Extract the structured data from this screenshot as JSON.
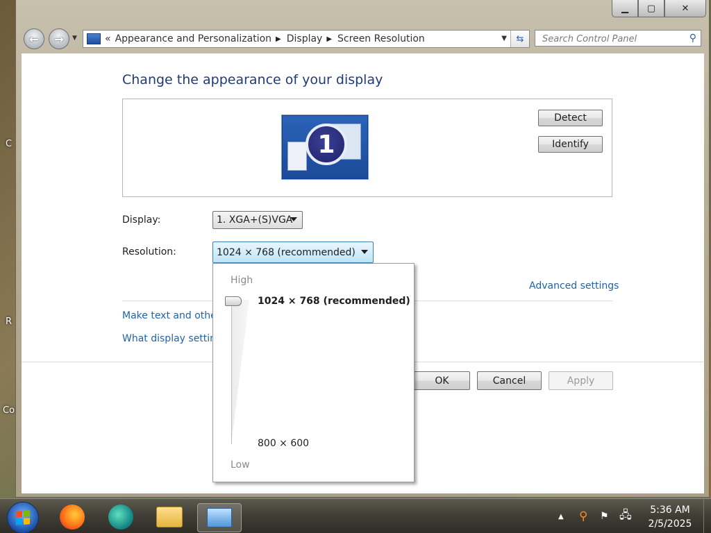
{
  "window": {
    "caption_buttons": [
      "minimize",
      "maximize",
      "close"
    ]
  },
  "nav": {
    "breadcrumbs": [
      "Appearance and Personalization",
      "Display",
      "Screen Resolution"
    ],
    "overflow": "«",
    "search_placeholder": "Search Control Panel"
  },
  "main": {
    "title": "Change the appearance of your display",
    "monitor_number": "1",
    "detect_label": "Detect",
    "identify_label": "Identify",
    "display_label": "Display:",
    "display_value": "1. XGA+(S)VGA",
    "resolution_label": "Resolution:",
    "resolution_value": "1024 × 768 (recommended)",
    "advanced_link": "Advanced settings",
    "link_text_size": "Make text and othe",
    "link_display_settings": "What display setting",
    "ok_label": "OK",
    "cancel_label": "Cancel",
    "apply_label": "Apply"
  },
  "resolution_flyout": {
    "high_label": "High",
    "low_label": "Low",
    "top_option": "1024 × 768 (recommended)",
    "bottom_option": "800 × 600",
    "slider_level": 1.0
  },
  "desktop": {
    "labels": [
      "C",
      "R",
      "Co"
    ]
  },
  "taskbar": {
    "time": "5:36 AM",
    "date": "2/5/2025"
  }
}
